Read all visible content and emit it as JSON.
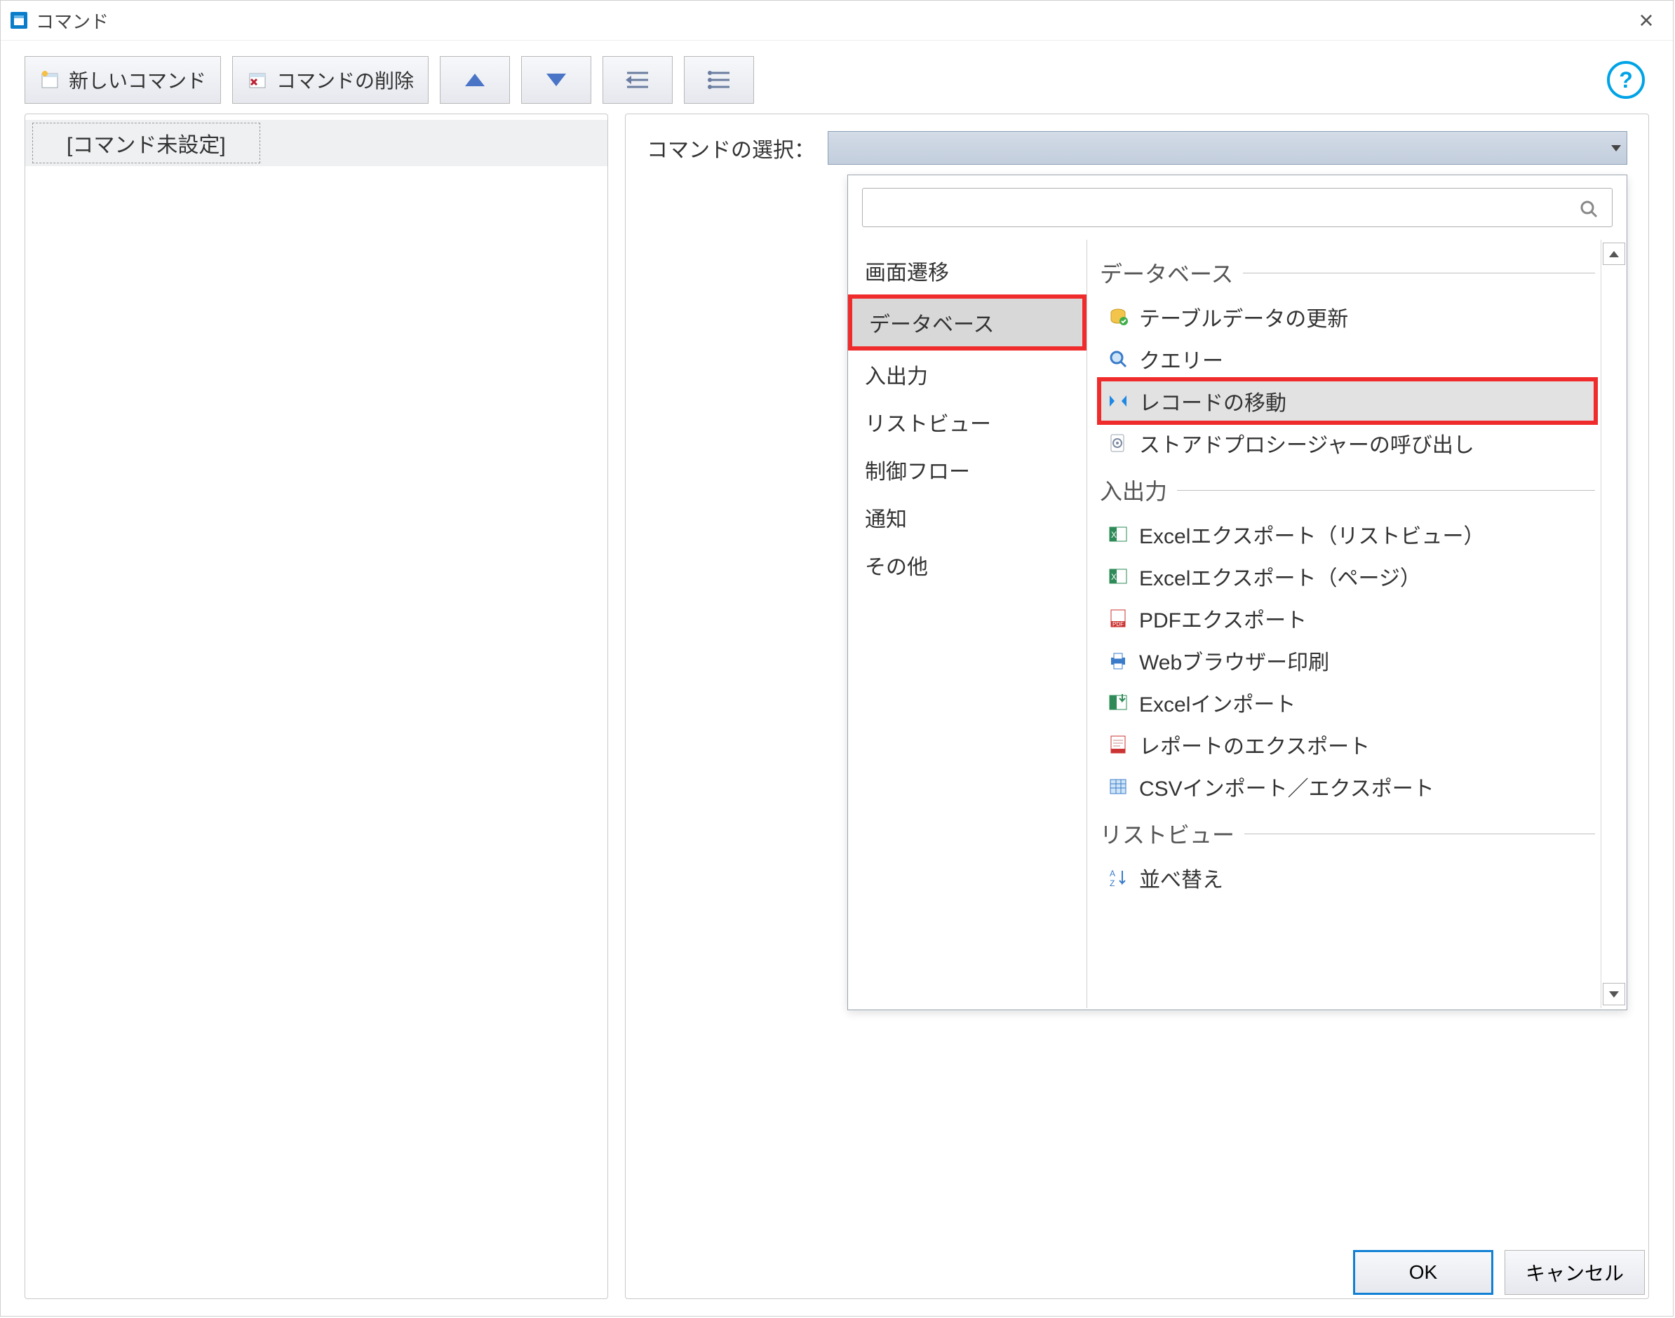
{
  "window": {
    "title": "コマンド"
  },
  "toolbar": {
    "new_cmd": "新しいコマンド",
    "del_cmd": "コマンドの削除"
  },
  "left": {
    "unset": "[コマンド未設定]"
  },
  "right": {
    "select_label": "コマンドの選択："
  },
  "popup": {
    "search_placeholder": "",
    "categories": [
      "画面遷移",
      "データベース",
      "入出力",
      "リストビュー",
      "制御フロー",
      "通知",
      "その他"
    ],
    "sections": {
      "database": {
        "title": "データベース",
        "items": [
          "テーブルデータの更新",
          "クエリー",
          "レコードの移動",
          "ストアドプロシージャーの呼び出し"
        ]
      },
      "io": {
        "title": "入出力",
        "items": [
          "Excelエクスポート（リストビュー）",
          "Excelエクスポート（ページ）",
          "PDFエクスポート",
          "Webブラウザー印刷",
          "Excelインポート",
          "レポートのエクスポート",
          "CSVインポート／エクスポート"
        ]
      },
      "listview": {
        "title": "リストビュー",
        "items": [
          "並べ替え"
        ]
      }
    }
  },
  "footer": {
    "ok": "OK",
    "cancel": "キャンセル"
  },
  "icons": {
    "db_refresh": "db-refresh-icon",
    "db_query": "magnifier-icon",
    "db_record_move": "record-nav-icon",
    "db_sproc": "gear-doc-icon",
    "io_excel_list": "excel-icon",
    "io_excel_page": "excel-icon",
    "io_pdf": "pdf-icon",
    "io_print": "printer-icon",
    "io_excel_import": "excel-import-icon",
    "io_report": "report-pdf-icon",
    "io_csv": "csv-icon",
    "lv_sort": "sort-icon"
  }
}
